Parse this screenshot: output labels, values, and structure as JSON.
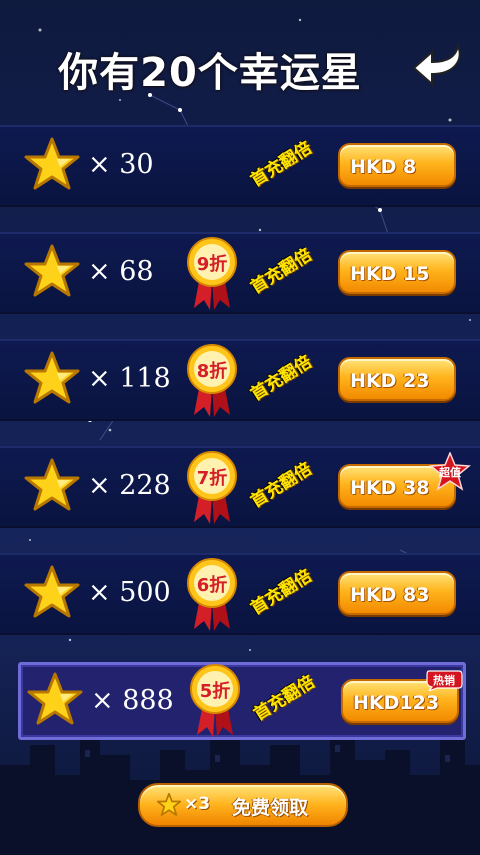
{
  "header": {
    "title": "你有20个幸运星"
  },
  "offers": [
    {
      "quantity": "× 30",
      "discount": "",
      "first_tag": "首充翻倍",
      "price": "HKD  8",
      "badge": ""
    },
    {
      "quantity": "× 68",
      "discount": "9折",
      "first_tag": "首充翻倍",
      "price": "HKD 15",
      "badge": ""
    },
    {
      "quantity": "× 118",
      "discount": "8折",
      "first_tag": "首充翻倍",
      "price": "HKD 23",
      "badge": ""
    },
    {
      "quantity": "× 228",
      "discount": "7折",
      "first_tag": "首充翻倍",
      "price": "HKD 38",
      "badge": "超值"
    },
    {
      "quantity": "× 500",
      "discount": "6折",
      "first_tag": "首充翻倍",
      "price": "HKD 83",
      "badge": ""
    },
    {
      "quantity": "× 888",
      "discount": "5折",
      "first_tag": "首充翻倍",
      "price": "HKD123",
      "badge": "热销"
    }
  ],
  "free_claim": {
    "quantity": "×3",
    "label": "免费领取"
  },
  "colors": {
    "background": "#132052",
    "button": "#ffb41d",
    "tag_text": "#ffe600",
    "ribbon": "#d41e28",
    "highlight_border": "#6f6cd8"
  },
  "icons": {
    "back": "back-arrow-icon",
    "star": "star-icon",
    "discount": "discount-medal-icon"
  }
}
